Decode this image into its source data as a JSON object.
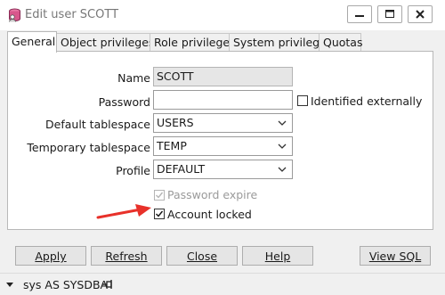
{
  "window": {
    "title": "Edit user SCOTT",
    "controls": [
      "minimize",
      "maximize",
      "close"
    ]
  },
  "tabs": [
    {
      "label": "General",
      "active": true
    },
    {
      "label": "Object privileges",
      "active": false
    },
    {
      "label": "Role privileges",
      "active": false
    },
    {
      "label": "System privileges",
      "active": false
    },
    {
      "label": "Quotas",
      "active": false
    }
  ],
  "form": {
    "name": {
      "label": "Name",
      "value": "SCOTT",
      "readonly": true
    },
    "password": {
      "label": "Password",
      "value": ""
    },
    "identified_externally": {
      "label": "Identified externally",
      "checked": false
    },
    "default_tablespace": {
      "label": "Default tablespace",
      "value": "USERS"
    },
    "temporary_tablespace": {
      "label": "Temporary tablespace",
      "value": "TEMP"
    },
    "profile": {
      "label": "Profile",
      "value": "DEFAULT"
    },
    "password_expire": {
      "label": "Password expire",
      "checked": true,
      "enabled": false
    },
    "account_locked": {
      "label": "Account locked",
      "checked": true,
      "enabled": true
    }
  },
  "buttons": {
    "apply": "Apply",
    "refresh": "Refresh",
    "close": "Close",
    "help": "Help",
    "view_sql": "View SQL"
  },
  "status": {
    "session": "sys AS SYSDBA"
  },
  "colors": {
    "window_bg": "#f0f0f0",
    "panel_bg": "#ffffff",
    "annotation_arrow": "#e8312a",
    "disabled_text": "#9a9a9a"
  }
}
